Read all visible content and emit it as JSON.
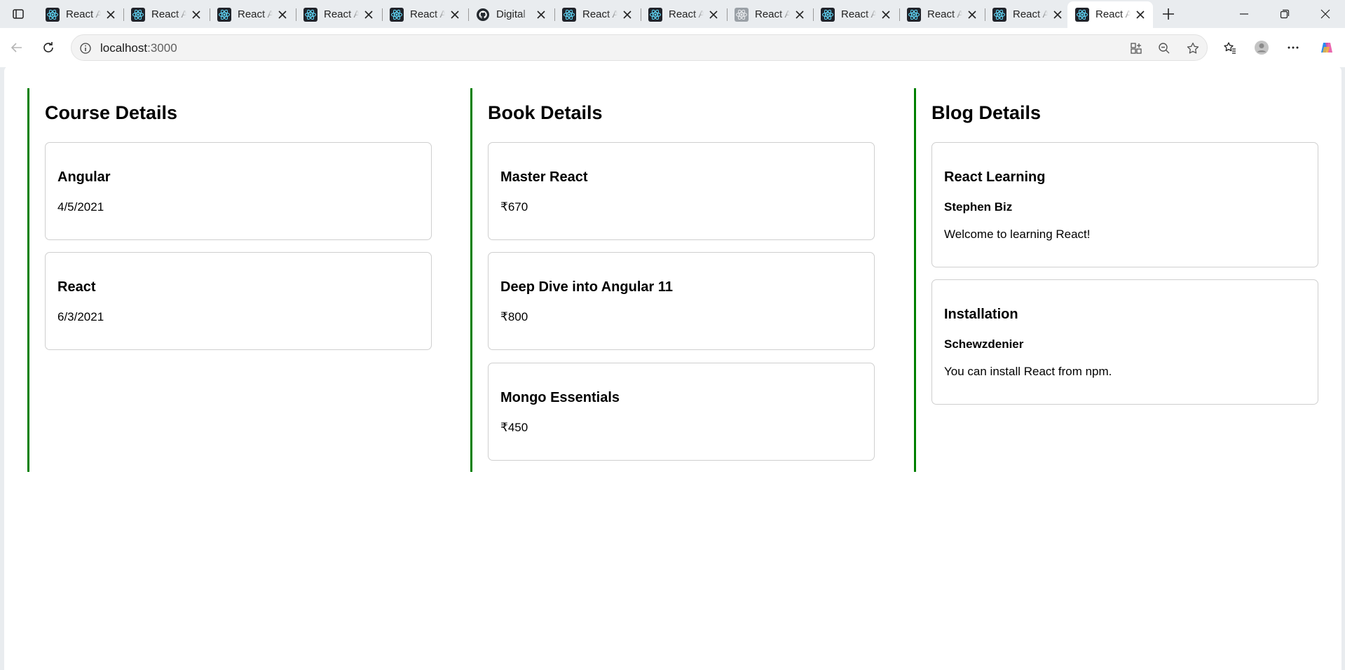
{
  "browser": {
    "tabs": [
      {
        "title": "React App",
        "favicon": "react-icon",
        "active": false
      },
      {
        "title": "React App",
        "favicon": "react-icon",
        "active": false
      },
      {
        "title": "React App",
        "favicon": "react-icon",
        "active": false
      },
      {
        "title": "React App",
        "favicon": "react-icon",
        "active": false
      },
      {
        "title": "React App",
        "favicon": "react-icon",
        "active": false
      },
      {
        "title": "Digital",
        "favicon": "github-icon",
        "active": false
      },
      {
        "title": "React App",
        "favicon": "react-icon",
        "active": false
      },
      {
        "title": "React App",
        "favicon": "react-icon",
        "active": false
      },
      {
        "title": "React App",
        "favicon": "react-gray-icon",
        "active": false
      },
      {
        "title": "React App",
        "favicon": "react-icon",
        "active": false
      },
      {
        "title": "React App",
        "favicon": "react-icon",
        "active": false
      },
      {
        "title": "React App",
        "favicon": "react-icon",
        "active": false
      },
      {
        "title": "React App",
        "favicon": "react-icon",
        "active": true
      }
    ],
    "url_host": "localhost",
    "url_port": ":3000",
    "accent_color": "#008000"
  },
  "page": {
    "courses": {
      "heading": "Course Details",
      "items": [
        {
          "name": "Angular",
          "date": "4/5/2021"
        },
        {
          "name": "React",
          "date": "6/3/2021"
        }
      ]
    },
    "books": {
      "heading": "Book Details",
      "items": [
        {
          "name": "Master React",
          "price": "₹670"
        },
        {
          "name": "Deep Dive into Angular 11",
          "price": "₹800"
        },
        {
          "name": "Mongo Essentials",
          "price": "₹450"
        }
      ]
    },
    "blogs": {
      "heading": "Blog Details",
      "items": [
        {
          "title": "React Learning",
          "author": "Stephen Biz",
          "content": "Welcome to learning React!"
        },
        {
          "title": "Installation",
          "author": "Schewzdenier",
          "content": "You can install React from npm."
        }
      ]
    }
  }
}
